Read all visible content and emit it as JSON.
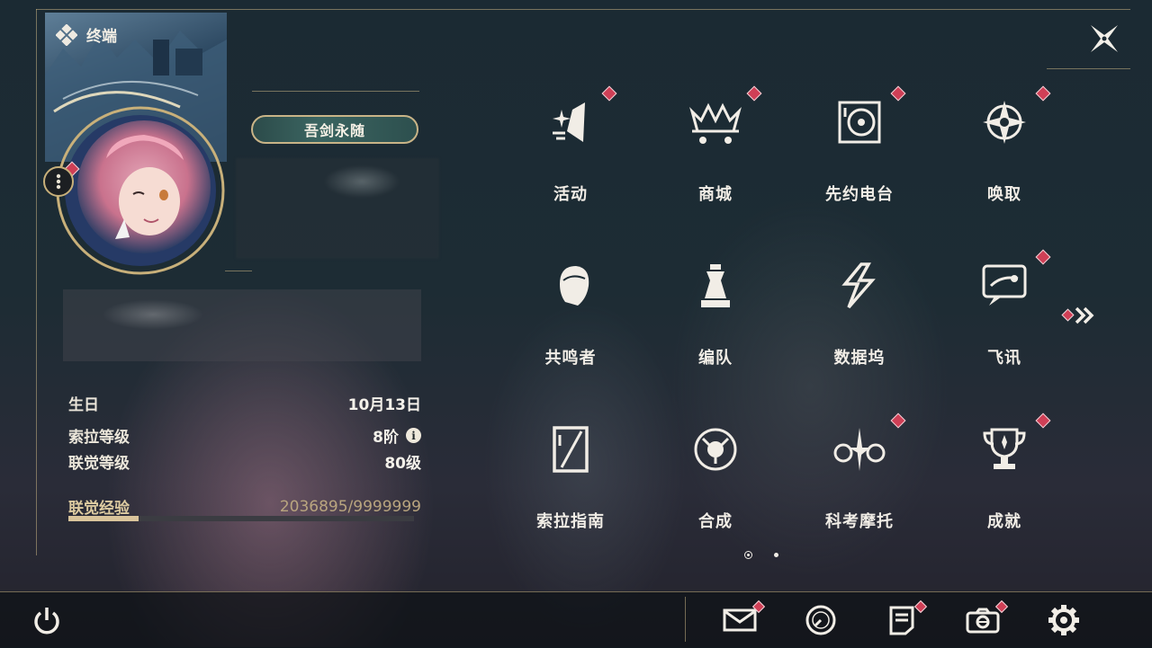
{
  "header": {
    "terminal_label": "终端"
  },
  "profile": {
    "title_badge": "吾剑永随",
    "info": [
      {
        "key": "生日",
        "value": "10月13日"
      },
      {
        "key": "索拉等级",
        "value": "8阶"
      },
      {
        "key": "联觉等级",
        "value": "80级"
      }
    ],
    "info_icon_glyph": "i",
    "exp": {
      "label": "联觉经验",
      "value": "2036895/9999999",
      "progress": 0.204
    }
  },
  "menu": {
    "items": [
      {
        "label": "活动",
        "icon": "sparkle-event-icon",
        "badge": true
      },
      {
        "label": "商城",
        "icon": "crown-cart-icon",
        "badge": true
      },
      {
        "label": "先约电台",
        "icon": "radio-disc-icon",
        "badge": true
      },
      {
        "label": "唤取",
        "icon": "compass-star-icon",
        "badge": true
      },
      {
        "label": "共鸣者",
        "icon": "character-head-icon",
        "badge": false
      },
      {
        "label": "编队",
        "icon": "chess-piece-icon",
        "badge": false
      },
      {
        "label": "数据坞",
        "icon": "data-dock-icon",
        "badge": false
      },
      {
        "label": "飞讯",
        "icon": "chat-bubble-icon",
        "badge": true
      },
      {
        "label": "索拉指南",
        "icon": "guide-book-icon",
        "badge": false
      },
      {
        "label": "合成",
        "icon": "synthesis-ring-icon",
        "badge": false
      },
      {
        "label": "科考摩托",
        "icon": "motorbike-icon",
        "badge": true
      },
      {
        "label": "成就",
        "icon": "trophy-icon",
        "badge": true
      }
    ],
    "page_indicator": {
      "current": 1,
      "total": 2
    }
  },
  "bottom_bar": {
    "buttons": [
      {
        "name": "mail-button",
        "icon": "envelope-icon",
        "badge": true
      },
      {
        "name": "clock-button",
        "icon": "clock-icon",
        "badge": false
      },
      {
        "name": "notes-button",
        "icon": "document-icon",
        "badge": true
      },
      {
        "name": "camera-button",
        "icon": "camera-icon",
        "badge": true
      },
      {
        "name": "settings-button",
        "icon": "gear-icon",
        "badge": false
      }
    ]
  },
  "colors": {
    "accent_gold": "#c8b07a",
    "badge_red": "#cf3f56",
    "text": "#f1ede6"
  }
}
